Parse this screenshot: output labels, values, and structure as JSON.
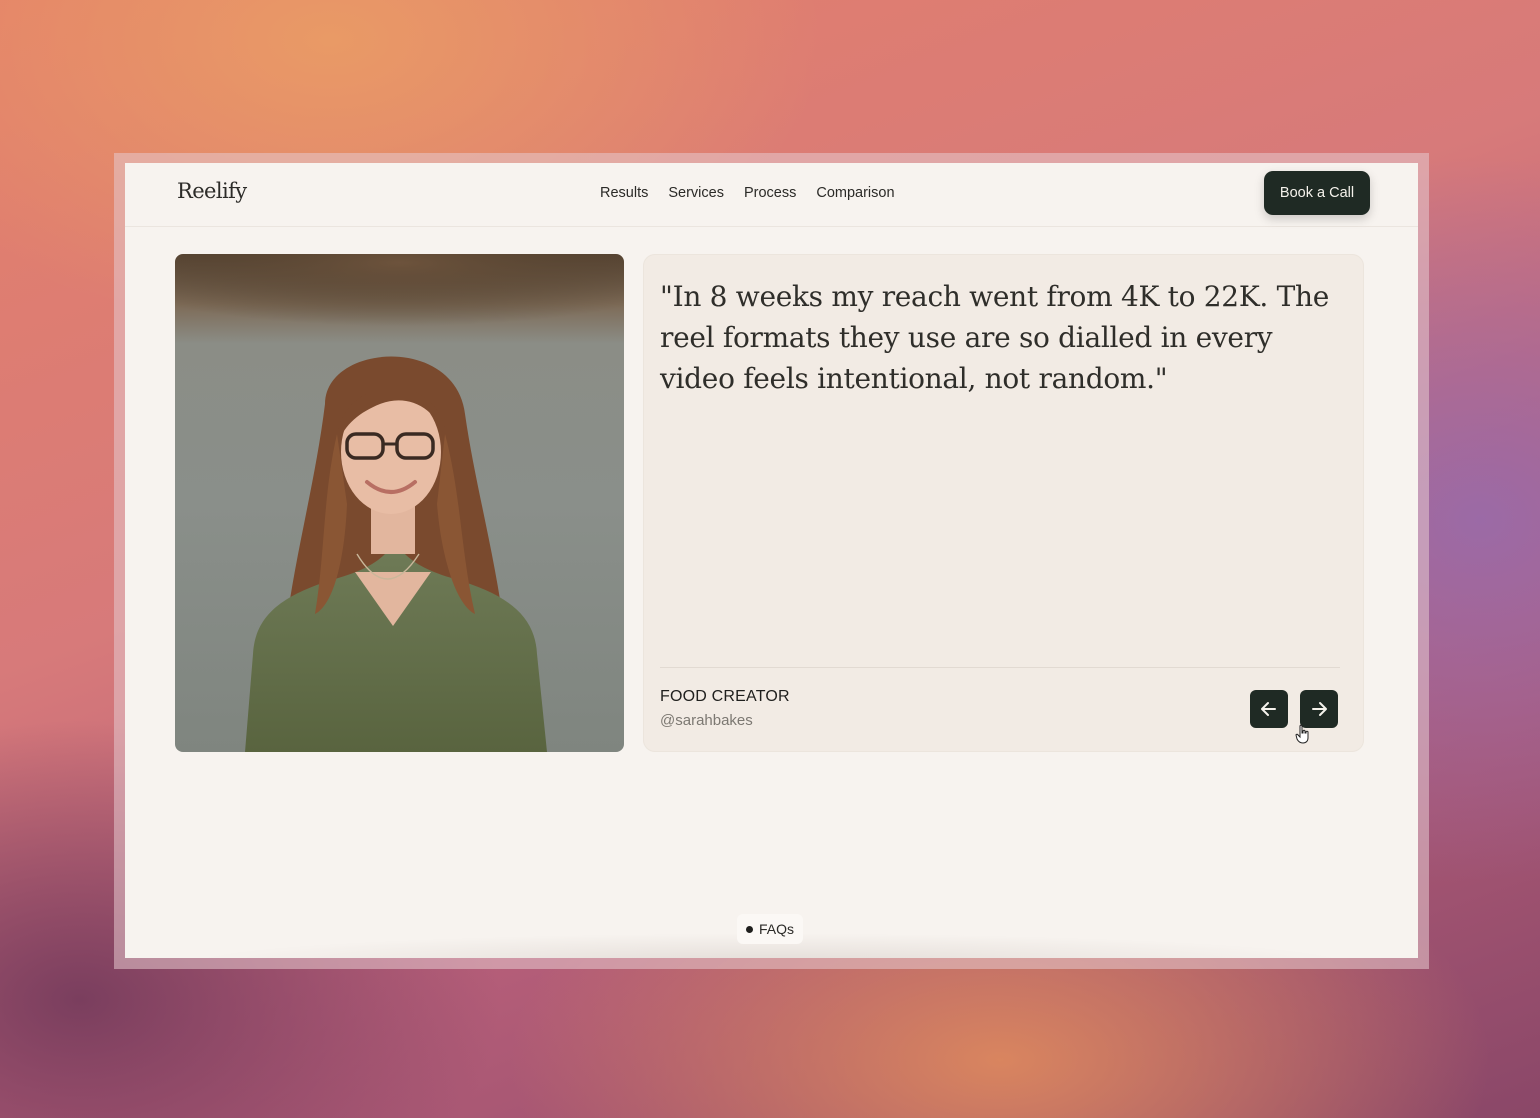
{
  "header": {
    "logo": "Reelify",
    "nav": [
      "Results",
      "Services",
      "Process",
      "Comparison"
    ],
    "cta": "Book a Call"
  },
  "testimonial": {
    "quote": "\"In 8 weeks my reach went from 4K to 22K. The reel formats they use are so dialled in  every video feels intentional, not random.\"",
    "role": "FOOD CREATOR",
    "handle": "@sarahbakes"
  },
  "controls": {
    "prev_icon": "arrow-left-icon",
    "next_icon": "arrow-right-icon"
  },
  "faq_chip": "FAQs",
  "colors": {
    "accent_dark": "#1f2a24",
    "page_bg": "#f7f3ef",
    "card_bg": "#f2ebe4"
  }
}
